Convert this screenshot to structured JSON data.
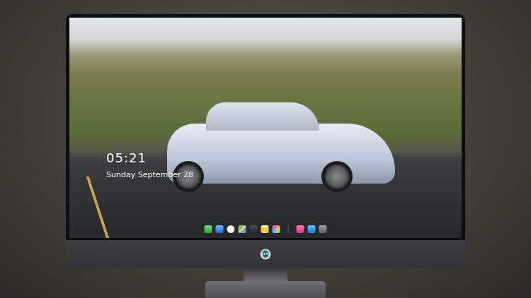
{
  "lock_screen": {
    "time": "05:21",
    "date": "Sunday September 28"
  }
}
